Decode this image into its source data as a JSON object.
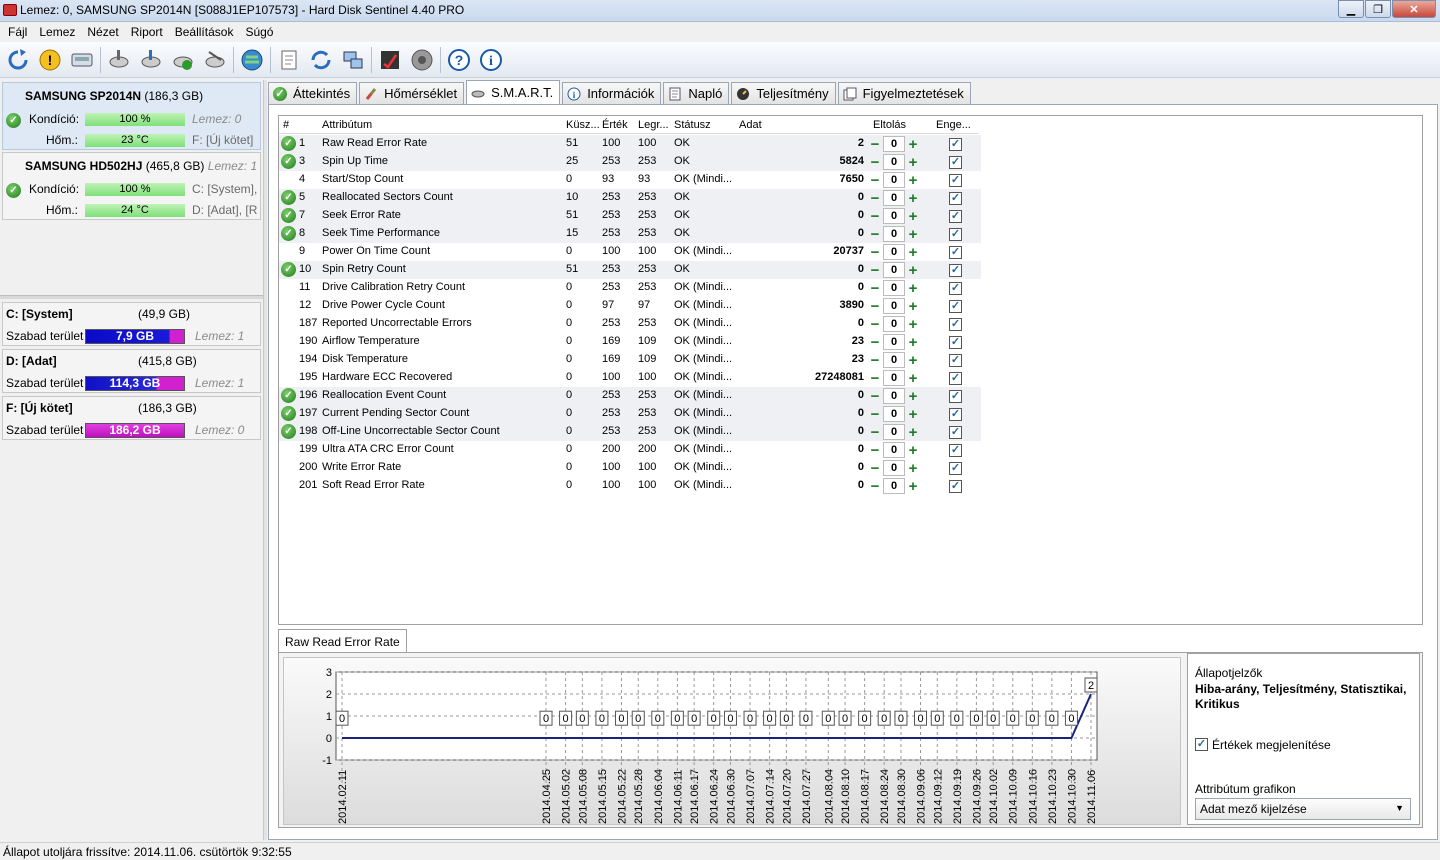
{
  "window": {
    "title": "Lemez: 0, SAMSUNG SP2014N [S088J1EP107573]  -  Hard Disk Sentinel 4.40 PRO"
  },
  "menu": [
    "Fájl",
    "Lemez",
    "Nézet",
    "Riport",
    "Beállítások",
    "Súgó"
  ],
  "toolbar_icons": [
    "refresh-icon",
    "alert-icon",
    "disk-icon",
    "disk-tool-icon",
    "disk-tool-2-icon",
    "disk-ok-icon",
    "disk-test-icon",
    "globe-icon",
    "report-icon",
    "refresh-disk-icon",
    "network-icon",
    "checklist-icon",
    "sound-icon",
    "help-icon",
    "info-icon"
  ],
  "disks": [
    {
      "name": "SAMSUNG SP2014N",
      "size": "(186,3 GB)",
      "condition_label": "Kondíció:",
      "condition_value": "100 %",
      "condition_pct": 100,
      "temp_label": "Hőm.:",
      "temp_value": "23 °C",
      "disk_index": "Lemez: 0",
      "volumes": "F: [Új kötet]"
    },
    {
      "name": "SAMSUNG HD502HJ",
      "size": "(465,8 GB)",
      "condition_label": "Kondíció:",
      "condition_value": "100 %",
      "condition_pct": 100,
      "temp_label": "Hőm.:",
      "temp_value": "24 °C",
      "disk_index": "Lemez: 1",
      "volumes": "C: [System],",
      "volumes2": "D: [Adat],  [R"
    }
  ],
  "volumes": [
    {
      "name": "C: [System]",
      "size": "(49,9 GB)",
      "free_label": "Szabad terület",
      "free": "7,9 GB",
      "disk": "Lemez: 1",
      "color": "#1515d0"
    },
    {
      "name": "D: [Adat]",
      "size": "(415,8 GB)",
      "free_label": "Szabad terület",
      "free": "114,3 GB",
      "disk": "Lemez: 1",
      "color": "#2020c8"
    },
    {
      "name": "F: [Új kötet]",
      "size": "(186,3 GB)",
      "free_label": "Szabad terület",
      "free": "186,2 GB",
      "disk": "Lemez: 0",
      "color": "#d020d0"
    }
  ],
  "tabs": [
    {
      "label": "Áttekintés",
      "icon": "ok-icon"
    },
    {
      "label": "Hőmérséklet",
      "icon": "thermometer-icon"
    },
    {
      "label": "S.M.A.R.T.",
      "icon": "disk-icon",
      "active": true
    },
    {
      "label": "Információk",
      "icon": "info-icon"
    },
    {
      "label": "Napló",
      "icon": "log-icon"
    },
    {
      "label": "Teljesítmény",
      "icon": "gauge-icon"
    },
    {
      "label": "Figyelmeztetések",
      "icon": "warnings-icon"
    }
  ],
  "smart_headers": {
    "num": "#",
    "attr": "Attribútum",
    "threshold": "Küsz...",
    "value": "Érték",
    "worst": "Legr...",
    "status": "Státusz",
    "data": "Adat",
    "offset": "Eltolás",
    "enable": "Enge..."
  },
  "smart_rows": [
    {
      "ok": true,
      "id": "1",
      "name": "Raw Read Error Rate",
      "thr": "51",
      "val": "100",
      "worst": "100",
      "status": "OK",
      "data": "2",
      "offset": "0"
    },
    {
      "ok": true,
      "id": "3",
      "name": "Spin Up Time",
      "thr": "25",
      "val": "253",
      "worst": "253",
      "status": "OK",
      "data": "5824",
      "offset": "0"
    },
    {
      "ok": false,
      "id": "4",
      "name": "Start/Stop Count",
      "thr": "0",
      "val": "93",
      "worst": "93",
      "status": "OK (Mindi...",
      "data": "7650",
      "offset": "0"
    },
    {
      "ok": true,
      "id": "5",
      "name": "Reallocated Sectors Count",
      "thr": "10",
      "val": "253",
      "worst": "253",
      "status": "OK",
      "data": "0",
      "offset": "0"
    },
    {
      "ok": true,
      "id": "7",
      "name": "Seek Error Rate",
      "thr": "51",
      "val": "253",
      "worst": "253",
      "status": "OK",
      "data": "0",
      "offset": "0"
    },
    {
      "ok": true,
      "id": "8",
      "name": "Seek Time Performance",
      "thr": "15",
      "val": "253",
      "worst": "253",
      "status": "OK",
      "data": "0",
      "offset": "0"
    },
    {
      "ok": false,
      "id": "9",
      "name": "Power On Time Count",
      "thr": "0",
      "val": "100",
      "worst": "100",
      "status": "OK (Mindi...",
      "data": "20737",
      "offset": "0"
    },
    {
      "ok": true,
      "id": "10",
      "name": "Spin Retry Count",
      "thr": "51",
      "val": "253",
      "worst": "253",
      "status": "OK",
      "data": "0",
      "offset": "0"
    },
    {
      "ok": false,
      "id": "11",
      "name": "Drive Calibration Retry Count",
      "thr": "0",
      "val": "253",
      "worst": "253",
      "status": "OK (Mindi...",
      "data": "0",
      "offset": "0"
    },
    {
      "ok": false,
      "id": "12",
      "name": "Drive Power Cycle Count",
      "thr": "0",
      "val": "97",
      "worst": "97",
      "status": "OK (Mindi...",
      "data": "3890",
      "offset": "0"
    },
    {
      "ok": false,
      "id": "187",
      "name": "Reported Uncorrectable Errors",
      "thr": "0",
      "val": "253",
      "worst": "253",
      "status": "OK (Mindi...",
      "data": "0",
      "offset": "0"
    },
    {
      "ok": false,
      "id": "190",
      "name": "Airflow Temperature",
      "thr": "0",
      "val": "169",
      "worst": "109",
      "status": "OK (Mindi...",
      "data": "23",
      "offset": "0"
    },
    {
      "ok": false,
      "id": "194",
      "name": "Disk Temperature",
      "thr": "0",
      "val": "169",
      "worst": "109",
      "status": "OK (Mindi...",
      "data": "23",
      "offset": "0"
    },
    {
      "ok": false,
      "id": "195",
      "name": "Hardware ECC Recovered",
      "thr": "0",
      "val": "100",
      "worst": "100",
      "status": "OK (Mindi...",
      "data": "27248081",
      "offset": "0"
    },
    {
      "ok": true,
      "id": "196",
      "name": "Reallocation Event Count",
      "thr": "0",
      "val": "253",
      "worst": "253",
      "status": "OK (Mindi...",
      "data": "0",
      "offset": "0"
    },
    {
      "ok": true,
      "id": "197",
      "name": "Current Pending Sector Count",
      "thr": "0",
      "val": "253",
      "worst": "253",
      "status": "OK (Mindi...",
      "data": "0",
      "offset": "0"
    },
    {
      "ok": true,
      "id": "198",
      "name": "Off-Line Uncorrectable Sector Count",
      "thr": "0",
      "val": "253",
      "worst": "253",
      "status": "OK (Mindi...",
      "data": "0",
      "offset": "0"
    },
    {
      "ok": false,
      "id": "199",
      "name": "Ultra ATA CRC Error Count",
      "thr": "0",
      "val": "200",
      "worst": "200",
      "status": "OK (Mindi...",
      "data": "0",
      "offset": "0"
    },
    {
      "ok": false,
      "id": "200",
      "name": "Write Error Rate",
      "thr": "0",
      "val": "100",
      "worst": "100",
      "status": "OK (Mindi...",
      "data": "0",
      "offset": "0"
    },
    {
      "ok": false,
      "id": "201",
      "name": "Soft Read Error Rate",
      "thr": "0",
      "val": "100",
      "worst": "100",
      "status": "OK (Mindi...",
      "data": "0",
      "offset": "0"
    }
  ],
  "graph": {
    "tab_label": "Raw Read Error Rate",
    "status_label": "Állapotjelzők",
    "status_value": "Hiba-arány, Teljesítmény, Statisztikai, Kritikus",
    "show_values_label": "Értékek megjelenítése",
    "show_values_checked": true,
    "attr_graph_label": "Attribútum grafikon",
    "attr_graph_value": "Adat mező kijelzése"
  },
  "chart_data": {
    "type": "line",
    "title": "",
    "xlabel": "",
    "ylabel": "",
    "ylim": [
      -1,
      3
    ],
    "yticks": [
      "3",
      "2",
      "1",
      "0",
      "-1"
    ],
    "grid": true,
    "categories": [
      "2014.02.11",
      "2014.04.25",
      "2014.05.02",
      "2014.05.08",
      "2014.05.15",
      "2014.05.22",
      "2014.05.28",
      "2014.06.04",
      "2014.06.11",
      "2014.06.17",
      "2014.06.24",
      "2014.06.30",
      "2014.07.07",
      "2014.07.14",
      "2014.07.20",
      "2014.07.27",
      "2014.08.04",
      "2014.08.10",
      "2014.08.17",
      "2014.08.24",
      "2014.08.30",
      "2014.09.06",
      "2014.09.12",
      "2014.09.19",
      "2014.09.26",
      "2014.10.02",
      "2014.10.09",
      "2014.10.16",
      "2014.10.23",
      "2014.10.30",
      "2014.11.06"
    ],
    "values": [
      0,
      0,
      0,
      0,
      0,
      0,
      0,
      0,
      0,
      0,
      0,
      0,
      0,
      0,
      0,
      0,
      0,
      0,
      0,
      0,
      0,
      0,
      0,
      0,
      0,
      0,
      0,
      0,
      0,
      0,
      2
    ],
    "color": "#1a237e"
  },
  "status_bar": "Állapot utoljára frissítve: 2014.11.06. csütörtök 9:32:55"
}
